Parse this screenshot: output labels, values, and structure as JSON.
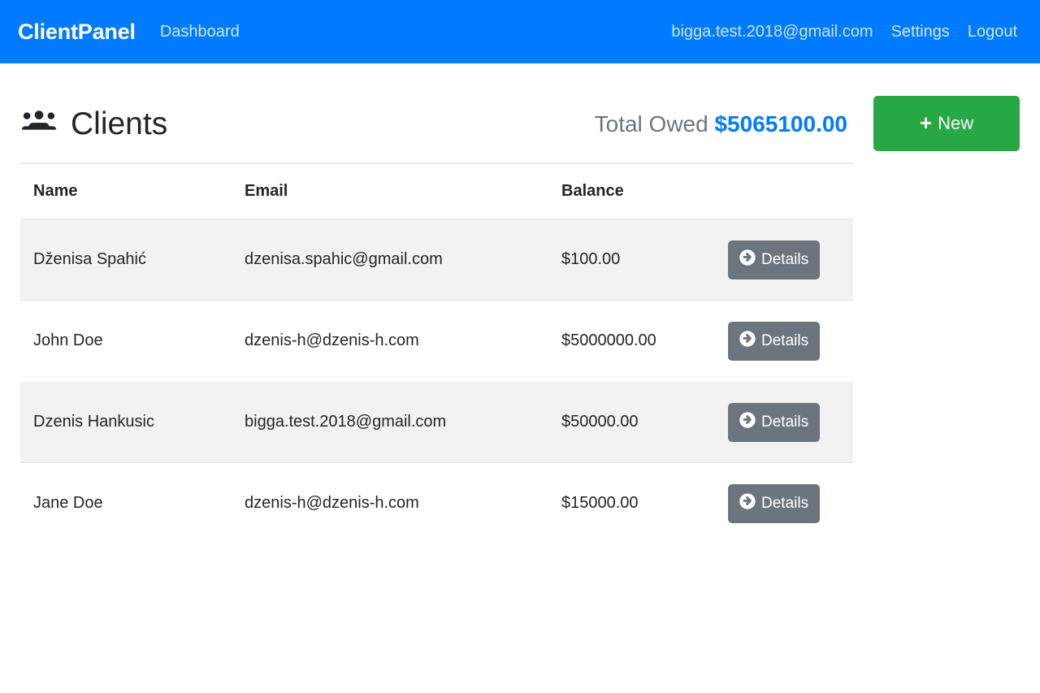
{
  "navbar": {
    "brand": "ClientPanel",
    "dashboard_label": "Dashboard",
    "user_email": "bigga.test.2018@gmail.com",
    "settings_label": "Settings",
    "logout_label": "Logout",
    "background_color": "#007bff"
  },
  "header": {
    "title": "Clients",
    "icon": "users-icon",
    "total_owed_label": "Total Owed",
    "total_owed_amount": "$5065100.00",
    "total_owed_amount_color": "#007bff",
    "new_button_label": "New",
    "new_button_icon": "plus-icon",
    "new_button_color": "#28a745"
  },
  "table": {
    "columns": [
      "Name",
      "Email",
      "Balance",
      ""
    ],
    "details_label": "Details",
    "details_icon": "arrow-circle-right-icon",
    "details_button_color": "#6c757d",
    "rows": [
      {
        "name": "Dženisa Spahić",
        "email": "dzenisa.spahic@gmail.com",
        "balance": "$100.00"
      },
      {
        "name": "John Doe",
        "email": "dzenis-h@dzenis-h.com",
        "balance": "$5000000.00"
      },
      {
        "name": "Dzenis Hankusic",
        "email": "bigga.test.2018@gmail.com",
        "balance": "$50000.00"
      },
      {
        "name": "Jane Doe",
        "email": "dzenis-h@dzenis-h.com",
        "balance": "$15000.00"
      }
    ]
  }
}
